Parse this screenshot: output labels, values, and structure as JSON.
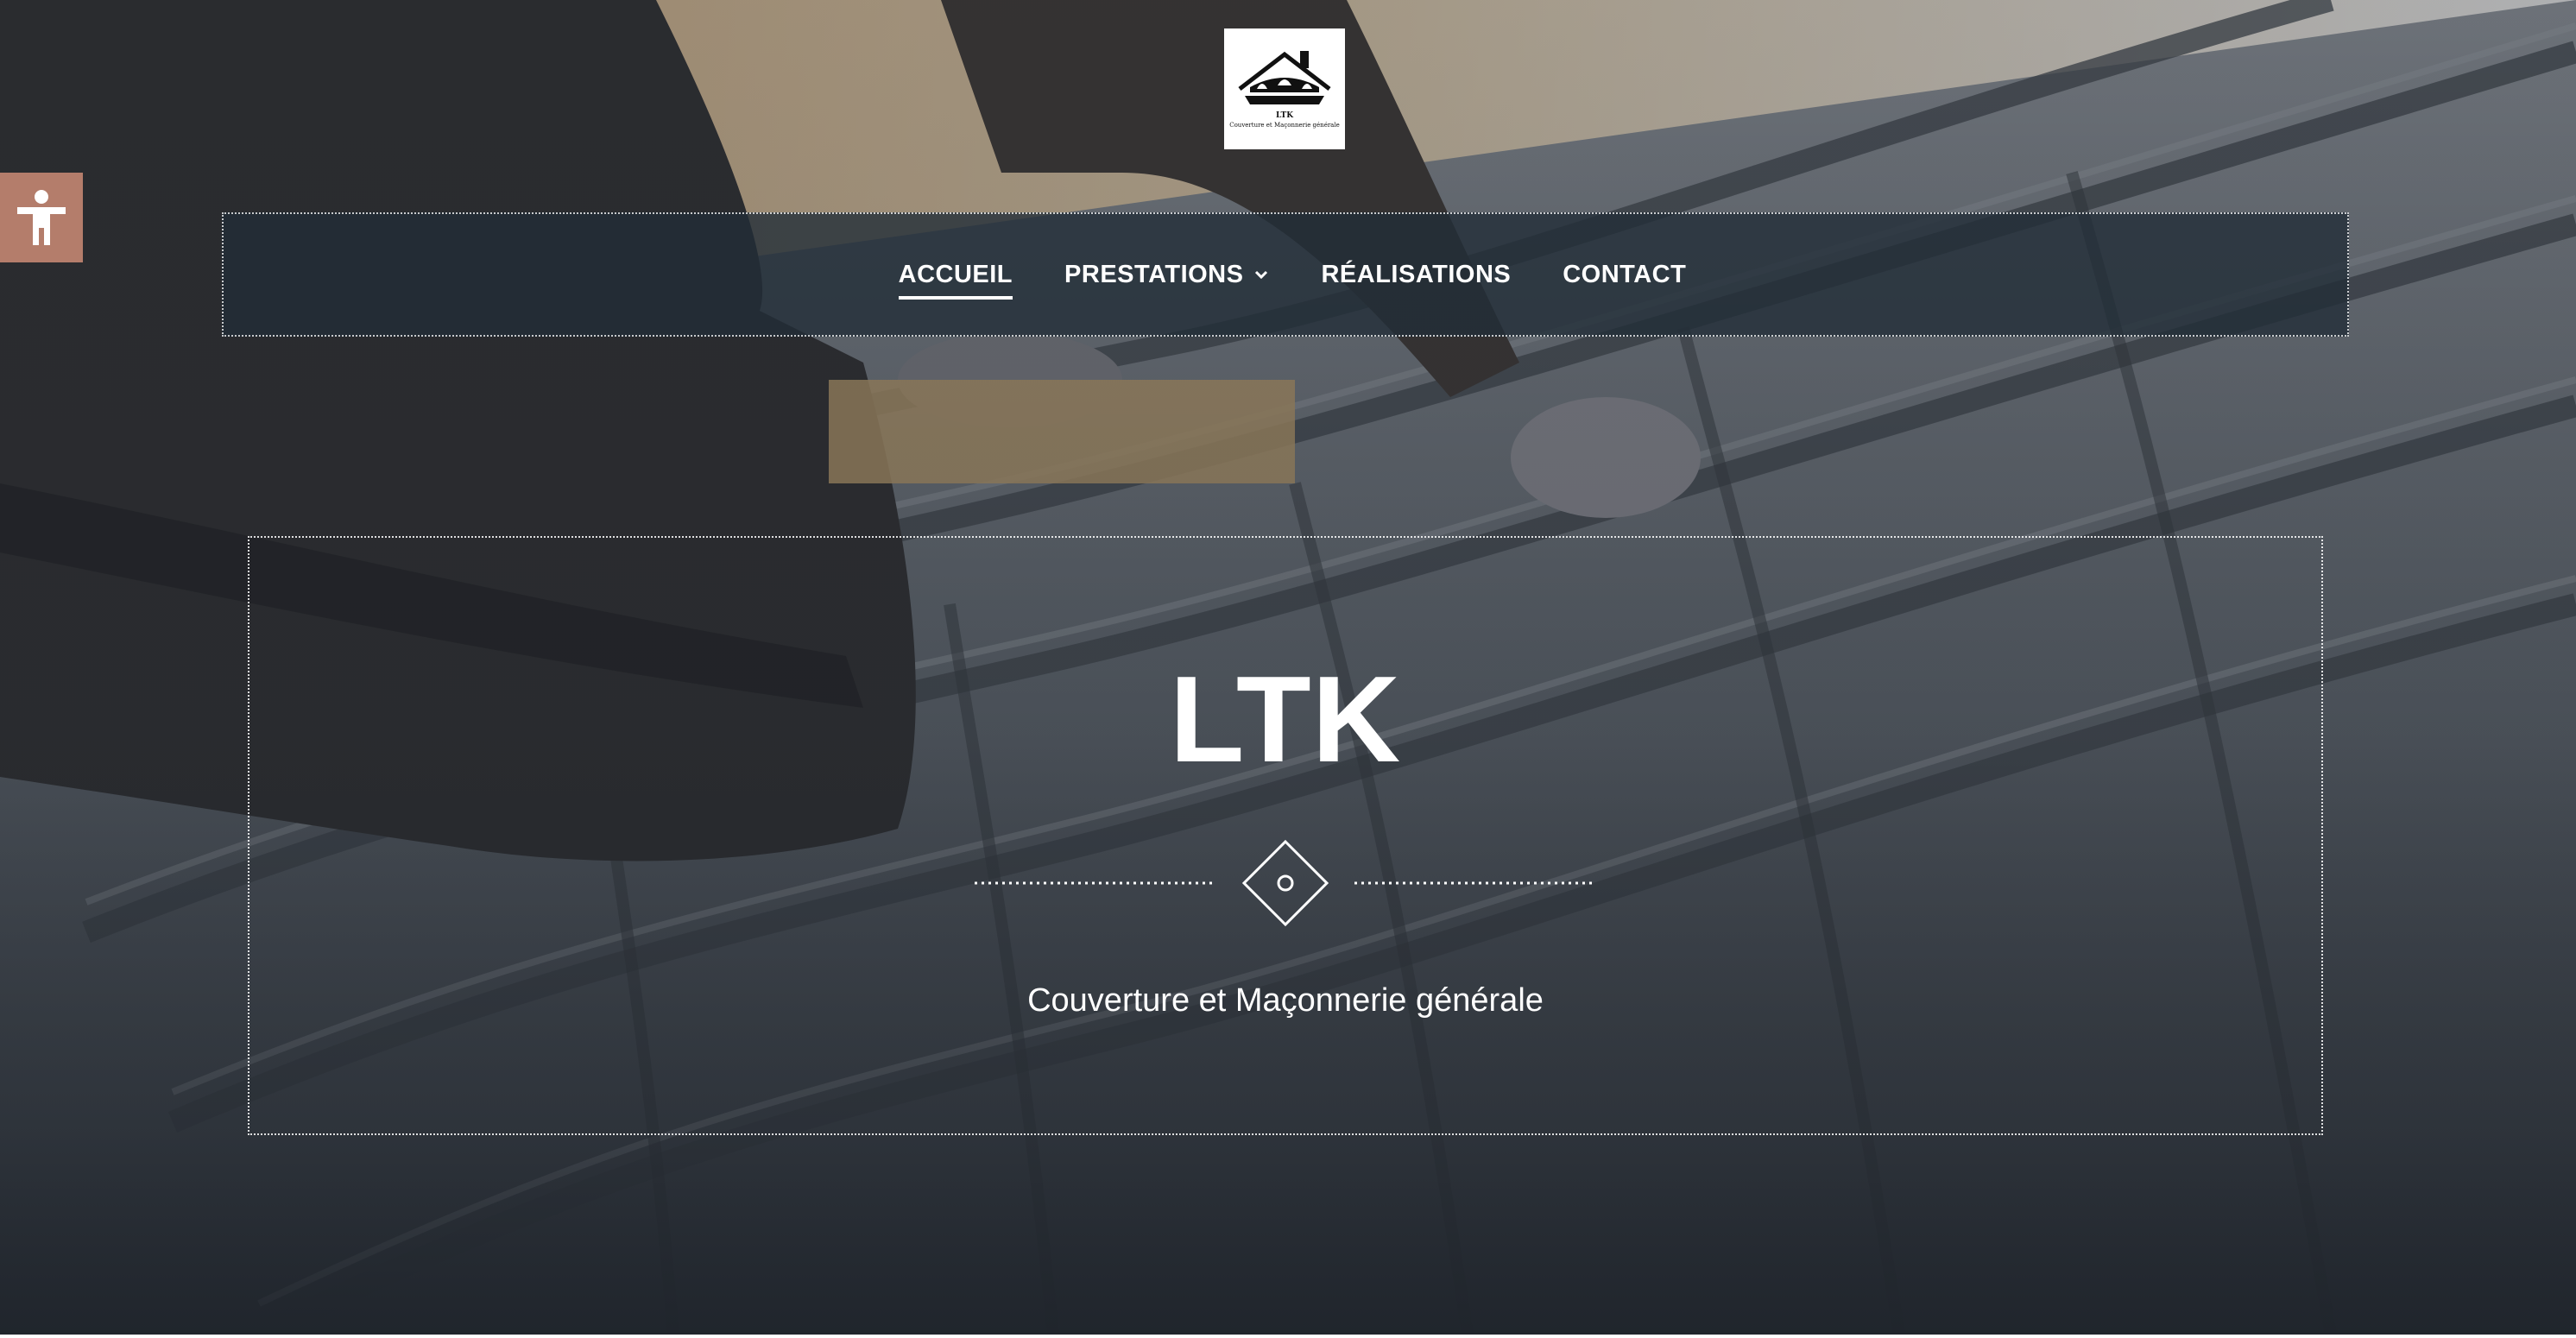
{
  "nav": {
    "items": [
      {
        "label": "ACCUEIL",
        "active": true
      },
      {
        "label": "PRESTATIONS",
        "has_dropdown": true
      },
      {
        "label": "RÉALISATIONS"
      },
      {
        "label": "CONTACT"
      }
    ]
  },
  "logo": {
    "name": "LTK",
    "tagline": "Couverture et Maçonnerie générale"
  },
  "hero": {
    "title": "LTK",
    "subtitle": "Couverture et Maçonnerie générale"
  },
  "accessibility": {
    "icon": "accessibility-person-icon",
    "color": "#b47d6b"
  },
  "colors": {
    "nav_background": "#21303a",
    "text": "#ffffff"
  }
}
